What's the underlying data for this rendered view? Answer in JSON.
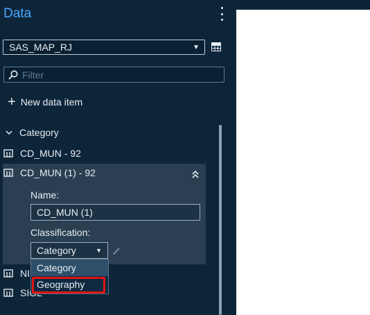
{
  "panel": {
    "title": "Data",
    "menu_icon": "kebab-icon"
  },
  "data_source": {
    "selected": "SAS_MAP_RJ",
    "grid_icon": "table-icon"
  },
  "filter": {
    "placeholder": "Filter",
    "value": ""
  },
  "new_data_item": {
    "label": "New data item",
    "icon": "plus-icon"
  },
  "category_group": {
    "label": "Category",
    "icon": "chevron-down-icon"
  },
  "items": [
    {
      "label": "CD_MUN - 92",
      "icon": "category-icon"
    },
    {
      "label": "CD_MUN (1) - 92",
      "icon": "category-icon",
      "expanded": true
    },
    {
      "label": "NI",
      "icon": "category-icon"
    },
    {
      "label": "SIGL",
      "icon": "category-icon"
    }
  ],
  "details": {
    "name_label": "Name:",
    "name_value": "CD_MUN (1)",
    "classification_label": "Classification:",
    "classification_value": "Category"
  },
  "classification_options": [
    {
      "label": "Category",
      "state": "hover"
    },
    {
      "label": "Geography",
      "state": "highlighted"
    }
  ],
  "colors": {
    "panel_bg": "#0d2539",
    "title_accent": "#4aa8ff",
    "card_bg": "#2a3f51",
    "highlight": "#e01414"
  }
}
